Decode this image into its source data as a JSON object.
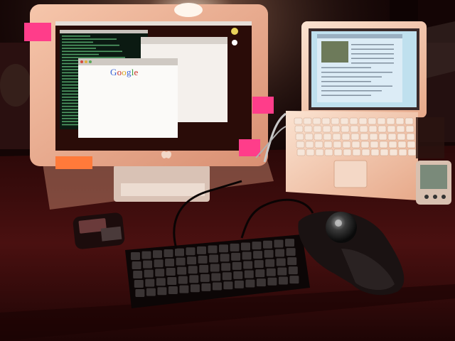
{
  "scene": {
    "description_free": true,
    "colors": {
      "wall": "#1a0808",
      "desk": "#3a0d0d",
      "monitor_bezel": "#e8a98e",
      "laptop_body": "#efc2a8",
      "sticky_note_pink": "#ff3d8a",
      "sticky_note_orange": "#ff7a3a",
      "terminal_bg": "#0b1a12",
      "terminal_text": "#6fd98a"
    },
    "icons": [
      "apple-logo-icon",
      "trackball-icon",
      "pda-icon",
      "phone-icon",
      "keyboard-icon"
    ]
  },
  "monitor": {
    "browser": {
      "logo_letters": [
        "G",
        "o",
        "o",
        "g",
        "l",
        "e"
      ]
    }
  }
}
